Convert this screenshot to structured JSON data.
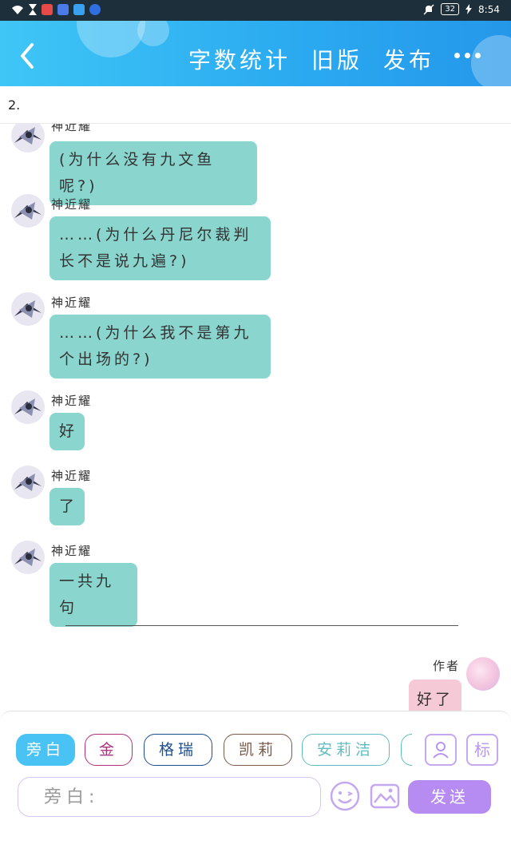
{
  "status_bar": {
    "battery": "32",
    "time": "8:54",
    "icons": [
      "wifi-icon",
      "hourglass-icon",
      "app-icon-red",
      "app-icon-blue",
      "cloud-icon",
      "bulb-icon",
      "mute-icon",
      "charging-icon"
    ]
  },
  "header": {
    "back_icon": "chevron-left-icon",
    "actions": [
      "字数统计",
      "旧版",
      "发布"
    ],
    "more_icon": "more-dots-icon",
    "gradient": [
      "#3fc6f6",
      "#2597ea"
    ]
  },
  "chapter_label": "2.",
  "messages": [
    {
      "name": "神近耀",
      "text": "(为什么没有九文鱼呢?)"
    },
    {
      "name": "神近耀",
      "lines": [
        "……(为什么丹尼尔裁判",
        "长不是说九遍?)"
      ]
    },
    {
      "name": "神近耀",
      "lines": [
        "……(为什么我不是第九",
        "个出场的?)"
      ]
    },
    {
      "name": "神近耀",
      "text": "好"
    },
    {
      "name": "神近耀",
      "text": "了"
    },
    {
      "name": "神近耀",
      "text": "一共九句"
    }
  ],
  "divider_text": "——————————————————————————",
  "author_message": {
    "name": "作者",
    "text": "好了"
  },
  "bubble_colors": {
    "character": "#8ad6cf",
    "author": "#f6c9d6"
  },
  "chips": [
    {
      "label": "旁白",
      "color": "#49c3f4",
      "filled": true
    },
    {
      "label": "金",
      "color": "#b0307c",
      "filled": false
    },
    {
      "label": "格瑞",
      "color": "#1d4f8c",
      "filled": false
    },
    {
      "label": "凯莉",
      "color": "#7a5a48",
      "filled": false
    },
    {
      "label": "安莉洁",
      "color": "#5fbcc0",
      "filled": false
    }
  ],
  "tools": {
    "character_icon": "person-card-icon",
    "tag_label": "标"
  },
  "input": {
    "placeholder": "旁白:"
  },
  "emoji_icon": "emoji-icon",
  "image_icon": "image-icon",
  "send_label": "发送",
  "accent": "#b68cf3"
}
